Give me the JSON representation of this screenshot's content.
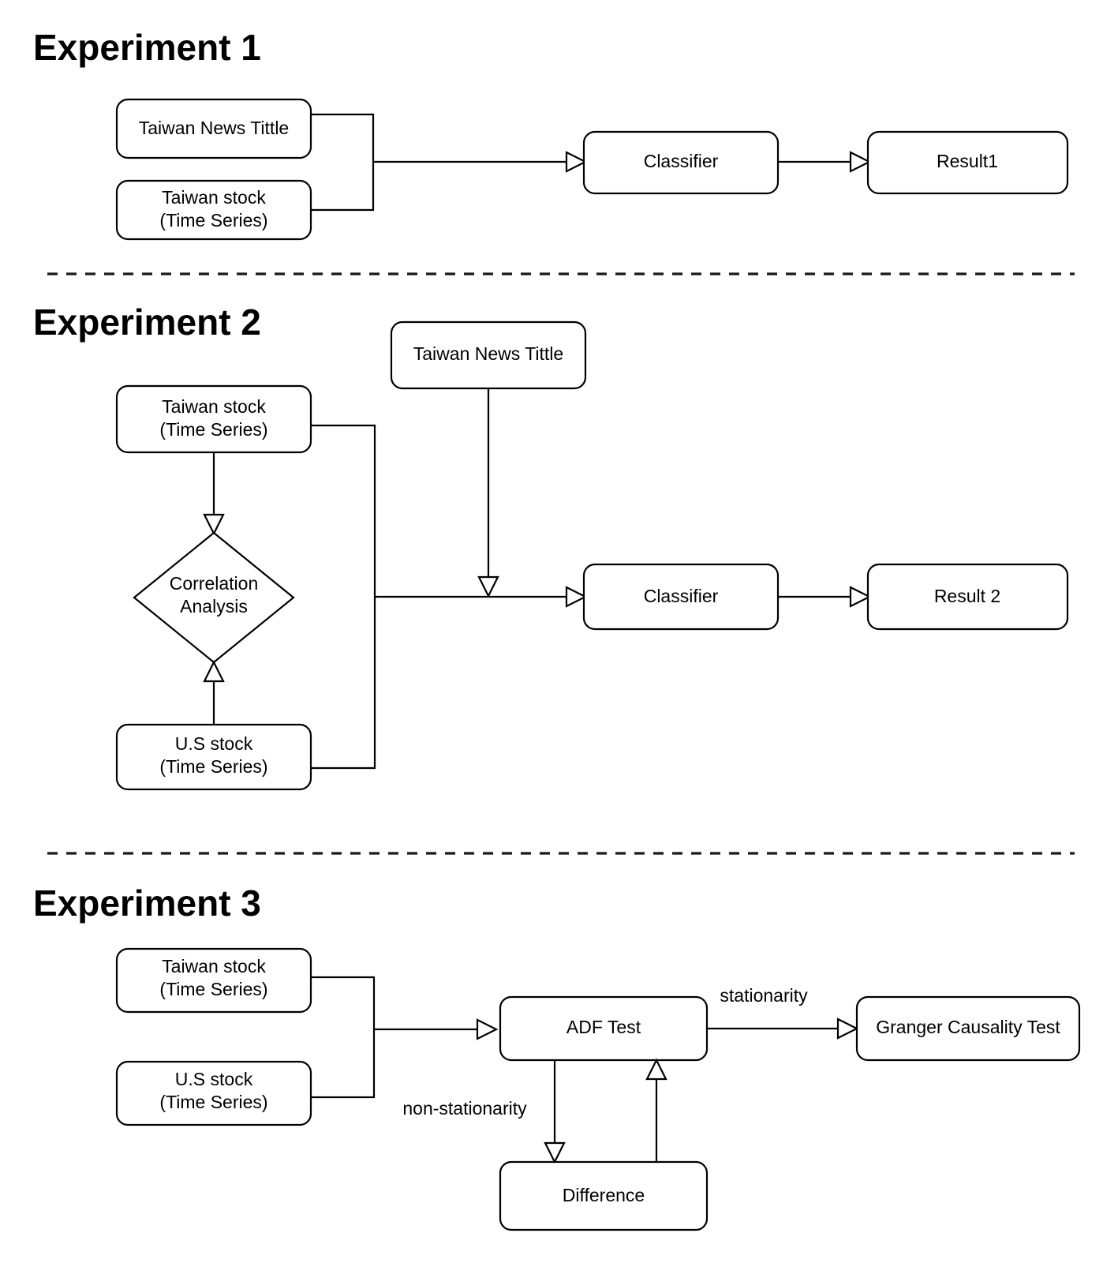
{
  "page": {
    "title": "Experiment pipeline flowcharts",
    "background_color": "#ffffff",
    "line_color": "#000000"
  },
  "sections": [
    {
      "id": "experiment-1",
      "title": "Experiment 1",
      "nodes": [
        {
          "id": "e1-news",
          "label": "Taiwan News Tittle",
          "shape": "rounded-rect"
        },
        {
          "id": "e1-tw-stock",
          "label_line1": "Taiwan stock",
          "label_line2": "(Time Series)",
          "shape": "rounded-rect"
        },
        {
          "id": "e1-classifier",
          "label": "Classifier",
          "shape": "rounded-rect"
        },
        {
          "id": "e1-result",
          "label": "Result1",
          "shape": "rounded-rect"
        }
      ],
      "edges": [
        {
          "from": "e1-news",
          "to": "e1-classifier",
          "label": ""
        },
        {
          "from": "e1-tw-stock",
          "to": "e1-classifier",
          "label": ""
        },
        {
          "from": "e1-classifier",
          "to": "e1-result",
          "label": ""
        }
      ]
    },
    {
      "id": "experiment-2",
      "title": "Experiment 2",
      "nodes": [
        {
          "id": "e2-tw-stock",
          "label_line1": "Taiwan stock",
          "label_line2": "(Time Series)",
          "shape": "rounded-rect"
        },
        {
          "id": "e2-news",
          "label": "Taiwan News Tittle",
          "shape": "rounded-rect"
        },
        {
          "id": "e2-corr",
          "label_line1": "Correlation",
          "label_line2": "Analysis",
          "shape": "diamond"
        },
        {
          "id": "e2-us-stock",
          "label_line1": "U.S stock",
          "label_line2": "(Time Series)",
          "shape": "rounded-rect"
        },
        {
          "id": "e2-classifier",
          "label": "Classifier",
          "shape": "rounded-rect"
        },
        {
          "id": "e2-result",
          "label": "Result 2",
          "shape": "rounded-rect"
        }
      ],
      "edges": [
        {
          "from": "e2-tw-stock",
          "to": "e2-corr",
          "label": ""
        },
        {
          "from": "e2-us-stock",
          "to": "e2-corr",
          "label": ""
        },
        {
          "from": "e2-tw-stock",
          "to": "e2-classifier",
          "label": ""
        },
        {
          "from": "e2-us-stock",
          "to": "e2-classifier",
          "label": ""
        },
        {
          "from": "e2-news",
          "to": "e2-classifier",
          "label": ""
        },
        {
          "from": "e2-classifier",
          "to": "e2-result",
          "label": ""
        }
      ]
    },
    {
      "id": "experiment-3",
      "title": "Experiment 3",
      "nodes": [
        {
          "id": "e3-tw-stock",
          "label_line1": "Taiwan stock",
          "label_line2": "(Time Series)",
          "shape": "rounded-rect"
        },
        {
          "id": "e3-us-stock",
          "label_line1": "U.S stock",
          "label_line2": "(Time Series)",
          "shape": "rounded-rect"
        },
        {
          "id": "e3-adf",
          "label": "ADF Test",
          "shape": "rounded-rect"
        },
        {
          "id": "e3-granger",
          "label": "Granger Causality Test",
          "shape": "rounded-rect"
        },
        {
          "id": "e3-diff",
          "label": "Difference",
          "shape": "rounded-rect"
        }
      ],
      "edges": [
        {
          "from": "e3-tw-stock",
          "to": "e3-adf",
          "label": ""
        },
        {
          "from": "e3-us-stock",
          "to": "e3-adf",
          "label": ""
        },
        {
          "from": "e3-adf",
          "to": "e3-granger",
          "label": "stationarity"
        },
        {
          "from": "e3-adf",
          "to": "e3-diff",
          "label": "non-stationarity"
        },
        {
          "from": "e3-diff",
          "to": "e3-adf",
          "label": ""
        }
      ]
    }
  ],
  "labels": {
    "exp1_title": "Experiment 1",
    "exp2_title": "Experiment 2",
    "exp3_title": "Experiment 3",
    "taiwan_news_tittle": "Taiwan News Tittle",
    "taiwan_stock_l1": "Taiwan stock",
    "time_series_l2": "(Time Series)",
    "us_stock_l1": "U.S stock",
    "classifier": "Classifier",
    "result1": "Result1",
    "result2": "Result 2",
    "correlation_l1": "Correlation",
    "correlation_l2": "Analysis",
    "adf_test": "ADF Test",
    "granger_causality_test": "Granger Causality Test",
    "difference": "Difference",
    "stationarity": "stationarity",
    "non_stationarity": "non-stationarity"
  }
}
